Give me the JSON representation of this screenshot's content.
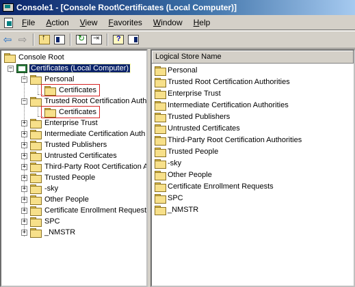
{
  "window": {
    "title": "Console1 - [Console Root\\Certificates (Local Computer)]"
  },
  "menu": [
    "File",
    "Action",
    "View",
    "Favorites",
    "Window",
    "Help"
  ],
  "toolbar": {
    "buttons": [
      "back-arrow-icon",
      "forward-arrow-icon",
      "up-one-level-icon",
      "show-hide-tree-icon",
      "refresh-icon",
      "export-list-icon",
      "help-icon",
      "properties-icon"
    ]
  },
  "tree": {
    "root": "Console Root",
    "snapin": "Certificates (Local Computer)",
    "nodes": [
      {
        "label": "Personal",
        "expanded": true,
        "child": "Certificates"
      },
      {
        "label": "Trusted Root Certification Auth",
        "expanded": true,
        "child": "Certificates"
      },
      {
        "label": "Enterprise Trust"
      },
      {
        "label": "Intermediate Certification Auth"
      },
      {
        "label": "Trusted Publishers"
      },
      {
        "label": "Untrusted Certificates"
      },
      {
        "label": "Third-Party Root Certification A"
      },
      {
        "label": "Trusted People"
      },
      {
        "label": "-sky"
      },
      {
        "label": "Other People"
      },
      {
        "label": "Certificate Enrollment Requests"
      },
      {
        "label": "SPC"
      },
      {
        "label": "_NMSTR"
      }
    ],
    "highlight_color": "#d42020"
  },
  "list": {
    "column_header": "Logical Store Name",
    "items": [
      "Personal",
      "Trusted Root Certification Authorities",
      "Enterprise Trust",
      "Intermediate Certification Authorities",
      "Trusted Publishers",
      "Untrusted Certificates",
      "Third-Party Root Certification Authorities",
      "Trusted People",
      "-sky",
      "Other People",
      "Certificate Enrollment Requests",
      "SPC",
      "_NMSTR"
    ]
  }
}
